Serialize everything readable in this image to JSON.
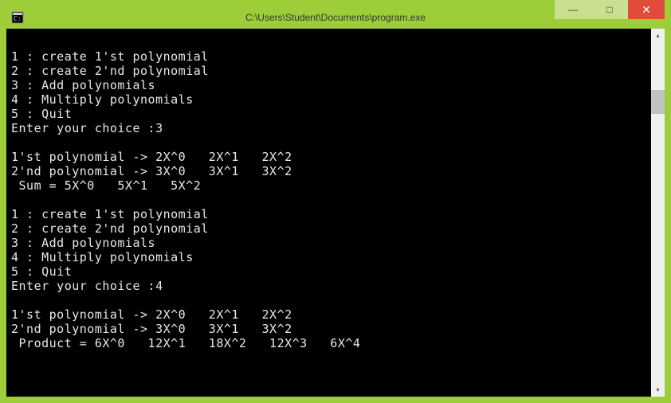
{
  "window": {
    "title": "C:\\Users\\Student\\Documents\\program.exe"
  },
  "controls": {
    "minimize": "—",
    "maximize": "□",
    "close": "✕"
  },
  "scroll": {
    "up": "▴",
    "down": "▾"
  },
  "console_lines": [
    "",
    "1 : create 1'st polynomial",
    "2 : create 2'nd polynomial",
    "3 : Add polynomials",
    "4 : Multiply polynomials",
    "5 : Quit",
    "Enter your choice :3",
    "",
    "1'st polynomial -> 2X^0   2X^1   2X^2",
    "2'nd polynomial -> 3X^0   3X^1   3X^2",
    " Sum = 5X^0   5X^1   5X^2",
    "",
    "1 : create 1'st polynomial",
    "2 : create 2'nd polynomial",
    "3 : Add polynomials",
    "4 : Multiply polynomials",
    "5 : Quit",
    "Enter your choice :4",
    "",
    "1'st polynomial -> 2X^0   2X^1   2X^2",
    "2'nd polynomial -> 3X^0   3X^1   3X^2",
    " Product = 6X^0   12X^1   18X^2   12X^3   6X^4"
  ]
}
